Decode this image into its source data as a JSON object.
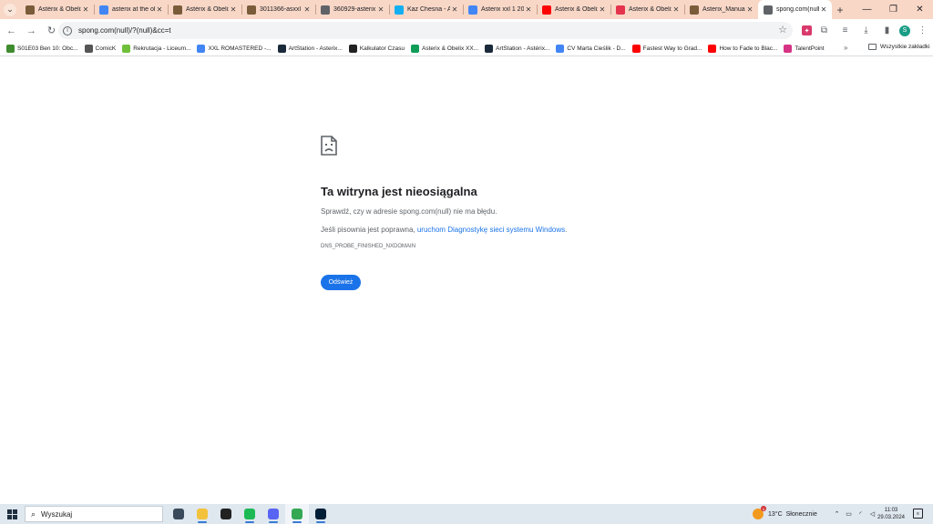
{
  "tabs": [
    {
      "title": "Astérix & Obelix",
      "favicon": "asterix-icon",
      "color": "#7a5c3a",
      "active": false
    },
    {
      "title": "asterix at the ol",
      "favicon": "google-icon",
      "color": "#4285f4",
      "active": false
    },
    {
      "title": "Astérix & Obelix",
      "favicon": "asterix-icon",
      "color": "#7a5c3a",
      "active": false
    },
    {
      "title": "3011366-asxxl",
      "favicon": "asterix-icon",
      "color": "#7a5c3a",
      "active": false
    },
    {
      "title": "360929-asterix",
      "favicon": "globe-icon",
      "color": "#5f6368",
      "active": false
    },
    {
      "title": "Kaz Chesna - A",
      "favicon": "artstation-icon",
      "color": "#13aff0",
      "active": false
    },
    {
      "title": "Asterix xxl 1 20",
      "favicon": "google-icon",
      "color": "#4285f4",
      "active": false
    },
    {
      "title": "Asterix & Obelix",
      "favicon": "youtube-icon",
      "color": "#ff0000",
      "active": false
    },
    {
      "title": "Asterix & Obelix",
      "favicon": "fandom-icon",
      "color": "#e5334b",
      "active": false
    },
    {
      "title": "Asterix_Manual",
      "favicon": "asterix-icon",
      "color": "#7a5c3a",
      "active": false
    },
    {
      "title": "spong.com(null)",
      "favicon": "globe-icon",
      "color": "#5f6368",
      "active": true
    }
  ],
  "window_controls": {
    "minimize": "—",
    "restore": "❐",
    "close": "✕"
  },
  "toolbar": {
    "back": "←",
    "forward": "→",
    "reload": "↻",
    "url": "spong.com(null)/?(null)&cc=t",
    "bookmark_star": "☆",
    "profile_initial": "S"
  },
  "bookmarks": [
    {
      "label": "S01E03 Ben 10: Obc...",
      "icon": "ben10-icon",
      "color": "#3f8c2f"
    },
    {
      "label": "ComicK",
      "icon": "comick-icon",
      "color": "#555555"
    },
    {
      "label": "Rekrutacja - Liceum...",
      "icon": "leaf-icon",
      "color": "#6fbf3a"
    },
    {
      "label": "XXL ROMASTERED -...",
      "icon": "docs-icon",
      "color": "#4285f4"
    },
    {
      "label": "ArtStation - Asterix...",
      "icon": "artstation-icon",
      "color": "#1b2a3a"
    },
    {
      "label": "Kalkulator Czasu",
      "icon": "clock-icon",
      "color": "#222222"
    },
    {
      "label": "Asterix & Obelix XX...",
      "icon": "sheets-icon",
      "color": "#0f9d58"
    },
    {
      "label": "ArtStation - Astérix...",
      "icon": "artstation-icon",
      "color": "#1b2a3a"
    },
    {
      "label": "CV Marta Cieślik - D...",
      "icon": "docs-icon",
      "color": "#4285f4"
    },
    {
      "label": "Fastest Way to Grad...",
      "icon": "youtube-icon",
      "color": "#ff0000"
    },
    {
      "label": "How to Fade to Blac...",
      "icon": "youtube-icon",
      "color": "#ff0000"
    },
    {
      "label": "TalentPoint",
      "icon": "talentpoint-icon",
      "color": "#d63384"
    }
  ],
  "bookmarks_more": "»",
  "all_bookmarks": "Wszystkie zakładki",
  "error": {
    "title": "Ta witryna jest nieosiągalna",
    "p1": "Sprawdź, czy w adresie spong.com(null) nie ma błędu.",
    "p2_prefix": "Jeśli pisownia jest poprawna, ",
    "p2_link": "uruchom Diagnostykę sieci systemu Windows",
    "p2_suffix": ".",
    "code": "DNS_PROBE_FINISHED_NXDOMAIN",
    "reload_label": "Odśwież"
  },
  "taskbar": {
    "search_placeholder": "Wyszukaj",
    "apps": [
      {
        "name": "task-view-icon",
        "color": "#3a4a5a",
        "running": false
      },
      {
        "name": "file-explorer-icon",
        "color": "#f3c23c",
        "running": true
      },
      {
        "name": "unity-icon",
        "color": "#222222",
        "running": false
      },
      {
        "name": "spotify-icon",
        "color": "#1db954",
        "running": true
      },
      {
        "name": "discord-icon",
        "color": "#5865f2",
        "running": true
      },
      {
        "name": "chrome-icon",
        "color": "#34a853",
        "running": true,
        "active": true
      },
      {
        "name": "photoshop-icon",
        "color": "#001e36",
        "running": true
      }
    ],
    "weather_temp": "13°C",
    "weather_desc": "Słonecznie",
    "weather_badge": "1",
    "time": "11:03",
    "date": "29.03.2024"
  }
}
